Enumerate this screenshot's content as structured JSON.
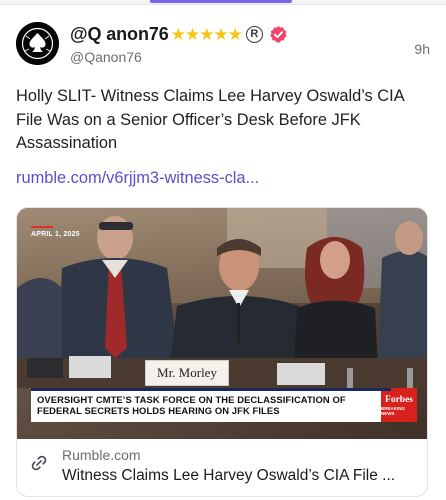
{
  "post": {
    "author": {
      "display_name": "@Q anon76",
      "stars": "★★★★★",
      "registered_mark": "R",
      "handle": "@Qanon76"
    },
    "timestamp": "9h",
    "text": "Holly SLIT- Witness Claims Lee Harvey Oswald’s CIA File Was on a Senior Officer’s Desk Before JFK Assassination",
    "link_text": "rumble.com/v6rjjm3-witness-cla..."
  },
  "embed": {
    "video_date": "APRIL 1, 2025",
    "nameplate": "Mr. Morley",
    "lower_third": "OVERSIGHT CMTE’S TASK FORCE ON THE DECLASSIFICATION OF FEDERAL SECRETS HOLDS HEARING ON JFK FILES",
    "brand": "Forbes",
    "brand_sub": "BREAKING NEWS",
    "domain": "Rumble.com",
    "title": "Witness Claims Lee Harvey Oswald’s CIA File ..."
  },
  "colors": {
    "accent": "#7a66e8",
    "link": "#5b4dd0",
    "verified_badge": "#f0446b",
    "stars": "#f5c518"
  },
  "icons": {
    "avatar": "spade-emblem-icon",
    "verified": "verified-badge-icon",
    "link": "link-icon"
  }
}
